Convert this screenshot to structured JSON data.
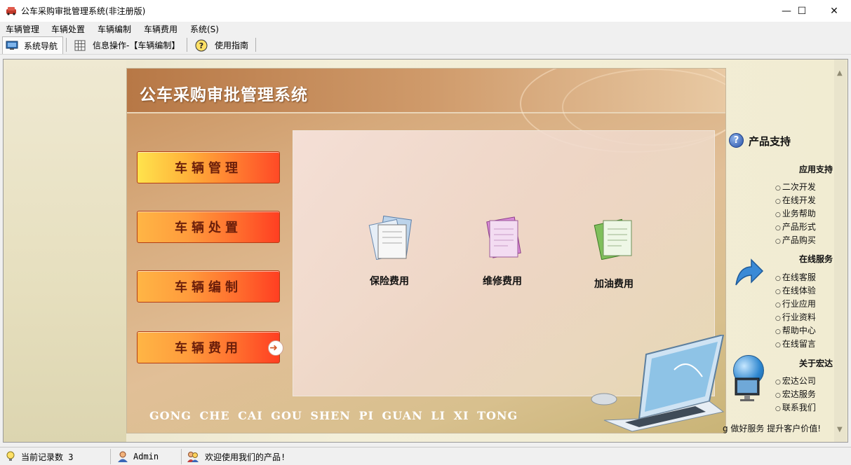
{
  "window": {
    "title": "公车采购审批管理系统(非注册版)",
    "minimize": "—",
    "maximize": "☐",
    "close": "✕"
  },
  "menu": [
    {
      "label": "车辆管理"
    },
    {
      "label": "车辆处置"
    },
    {
      "label": "车辆编制"
    },
    {
      "label": "车辆费用"
    },
    {
      "label": "系统(S)"
    }
  ],
  "toolbar": {
    "tabs": [
      {
        "label": "系统导航",
        "icon": "monitor-icon",
        "active": true
      },
      {
        "label": "信息操作-【车辆编制】",
        "icon": "grid-icon",
        "active": false
      },
      {
        "label": "使用指南",
        "icon": "help-icon",
        "active": false
      }
    ]
  },
  "panel": {
    "title": "公车采购审批管理系统",
    "pinyin": "GONG CHE CAI GOU SHEN PI GUAN LI XI TONG",
    "nav_buttons": [
      {
        "label": "车辆管理"
      },
      {
        "label": "车辆处置"
      },
      {
        "label": "车辆编制"
      },
      {
        "label": "车辆费用"
      }
    ],
    "items": [
      {
        "label": "保险费用",
        "icon": "insurance-doc-icon"
      },
      {
        "label": "维修费用",
        "icon": "repair-doc-icon"
      },
      {
        "label": "加油费用",
        "icon": "fuel-doc-icon"
      }
    ]
  },
  "support": {
    "title": "产品支持",
    "sections": [
      {
        "heading": "应用支持",
        "links": [
          "二次开发",
          "在线开发",
          "业务帮助",
          "产品形式",
          "产品购买"
        ]
      },
      {
        "heading": "在线服务",
        "links": [
          "在线客服",
          "在线体验",
          "行业应用",
          "行业资料",
          "帮助中心",
          "在线留言"
        ]
      },
      {
        "heading": "关于宏达",
        "links": [
          "宏达公司",
          "宏达服务",
          "联系我们"
        ]
      }
    ],
    "slogan": "g 做好服务  提升客户价值!"
  },
  "statusbar": {
    "records_label": "当前记录数 3",
    "user": "Admin",
    "welcome": "欢迎使用我们的产品!"
  },
  "colors": {
    "accent_orange": "#ff7a30",
    "brand_red": "#c0392b"
  }
}
